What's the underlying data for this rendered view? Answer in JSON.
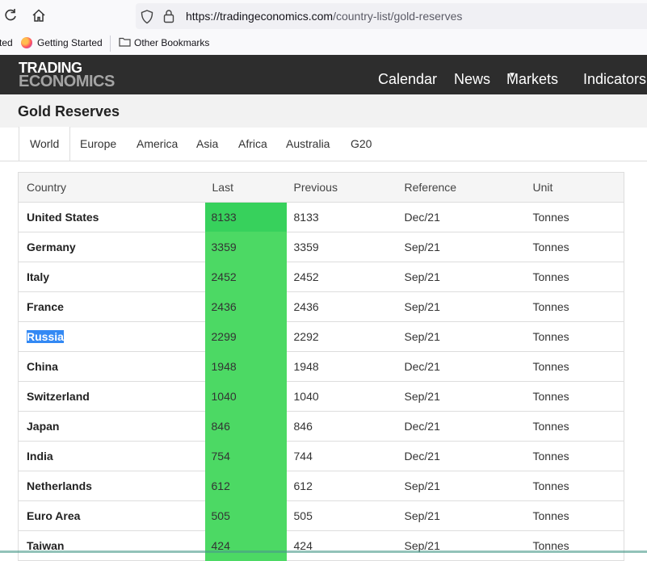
{
  "browser": {
    "url_host": "https://tradingeconomics.com",
    "url_path": "/country-list/gold-reserves",
    "bookmarks": {
      "cut_item": "ted",
      "getting_started": "Getting Started",
      "other": "Other Bookmarks"
    }
  },
  "site": {
    "logo_line1": "TRADING",
    "logo_line2": "ECONOMICS",
    "nav": {
      "calendar": "Calendar",
      "news": "News",
      "markets": "Markets",
      "indicators": "Indicators"
    }
  },
  "page": {
    "title": "Gold Reserves",
    "tabs": [
      "World",
      "Europe",
      "America",
      "Asia",
      "Africa",
      "Australia",
      "G20"
    ],
    "active_tab": "World"
  },
  "table": {
    "headers": {
      "country": "Country",
      "last": "Last",
      "previous": "Previous",
      "reference": "Reference",
      "unit": "Unit"
    },
    "rows": [
      {
        "country": "United States",
        "last": "8133",
        "previous": "8133",
        "reference": "Dec/21",
        "unit": "Tonnes"
      },
      {
        "country": "Germany",
        "last": "3359",
        "previous": "3359",
        "reference": "Sep/21",
        "unit": "Tonnes"
      },
      {
        "country": "Italy",
        "last": "2452",
        "previous": "2452",
        "reference": "Sep/21",
        "unit": "Tonnes"
      },
      {
        "country": "France",
        "last": "2436",
        "previous": "2436",
        "reference": "Sep/21",
        "unit": "Tonnes"
      },
      {
        "country": "Russia",
        "last": "2299",
        "previous": "2292",
        "reference": "Sep/21",
        "unit": "Tonnes",
        "selected": true
      },
      {
        "country": "China",
        "last": "1948",
        "previous": "1948",
        "reference": "Dec/21",
        "unit": "Tonnes"
      },
      {
        "country": "Switzerland",
        "last": "1040",
        "previous": "1040",
        "reference": "Sep/21",
        "unit": "Tonnes"
      },
      {
        "country": "Japan",
        "last": "846",
        "previous": "846",
        "reference": "Dec/21",
        "unit": "Tonnes"
      },
      {
        "country": "India",
        "last": "754",
        "previous": "744",
        "reference": "Dec/21",
        "unit": "Tonnes"
      },
      {
        "country": "Netherlands",
        "last": "612",
        "previous": "612",
        "reference": "Sep/21",
        "unit": "Tonnes"
      },
      {
        "country": "Euro Area",
        "last": "505",
        "previous": "505",
        "reference": "Sep/21",
        "unit": "Tonnes"
      },
      {
        "country": "Taiwan",
        "last": "424",
        "previous": "424",
        "reference": "Sep/21",
        "unit": "Tonnes"
      }
    ]
  },
  "colors": {
    "header_bg": "#2d2d2d",
    "last_cell_green": "#4cd964",
    "selection_blue": "#3389f4"
  }
}
